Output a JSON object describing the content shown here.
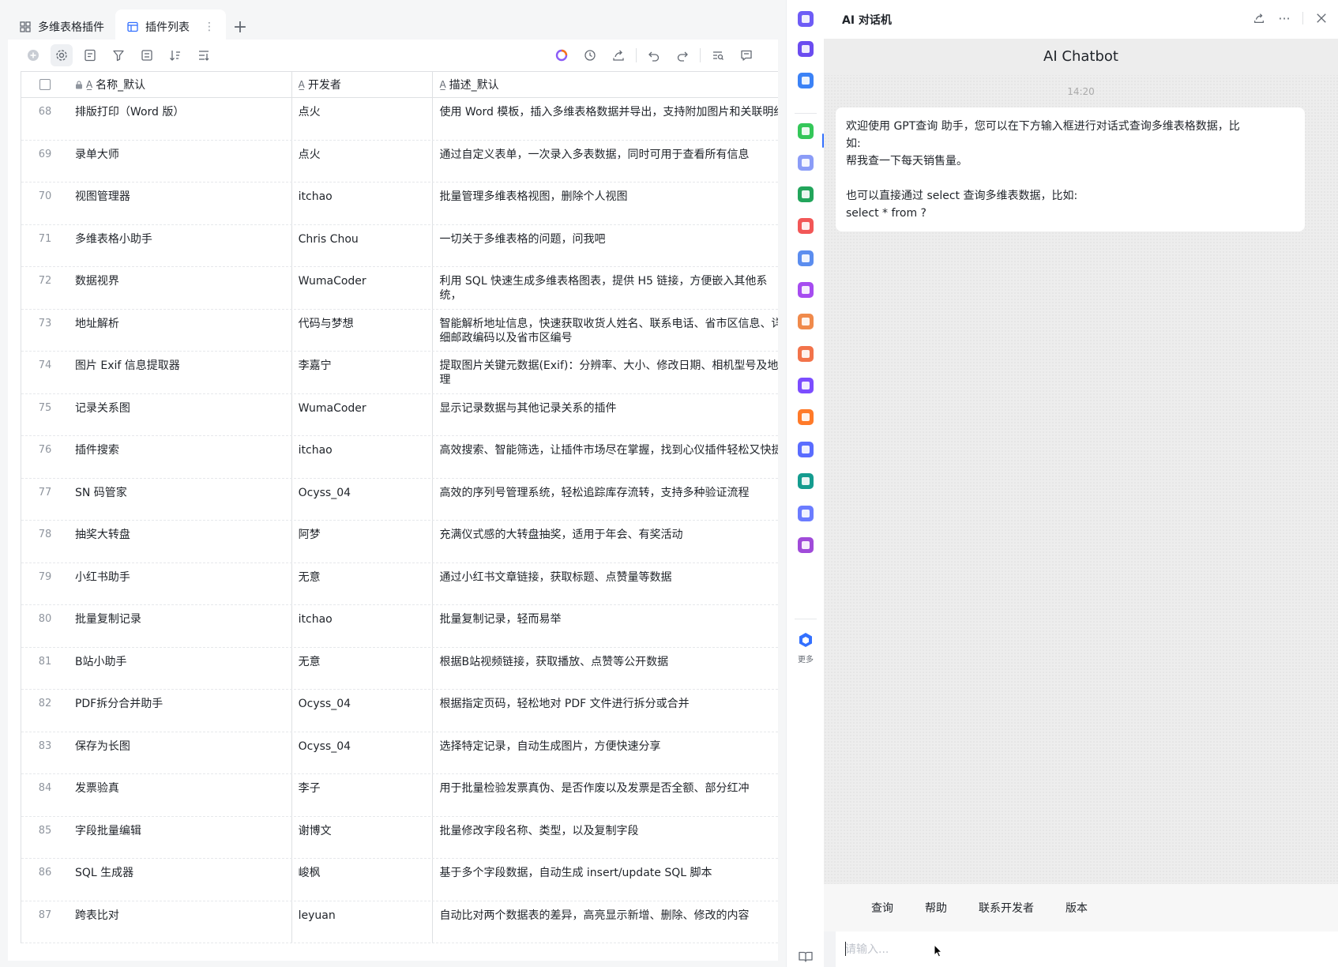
{
  "tabs": [
    {
      "label": "多维表格插件",
      "icon": "grid-icon",
      "active": false
    },
    {
      "label": "插件列表",
      "icon": "table-icon",
      "active": true
    }
  ],
  "table": {
    "columns": [
      {
        "label": "名称_默认",
        "icon": "text-field-icon",
        "locked": true
      },
      {
        "label": "开发者",
        "icon": "text-field-icon"
      },
      {
        "label": "描述_默认",
        "icon": "text-field-icon"
      }
    ],
    "rows": [
      {
        "idx": "68",
        "name": "排版打印（Word 版）",
        "dev": "点火",
        "desc": "使用 Word 模板，插入多维表格数据并导出，支持附加图片和关联明细"
      },
      {
        "idx": "69",
        "name": "录单大师",
        "dev": "点火",
        "desc": "通过自定义表单，一次录入多表数据，同时可用于查看所有信息"
      },
      {
        "idx": "70",
        "name": "视图管理器",
        "dev": "itchao",
        "desc": "批量管理多维表格视图，删除个人视图"
      },
      {
        "idx": "71",
        "name": "多维表格小助手",
        "dev": "Chris Chou",
        "desc": "一切关于多维表格的问题，问我吧"
      },
      {
        "idx": "72",
        "name": "数据视界",
        "dev": "WumaCoder",
        "desc": "利用 SQL 快速生成多维表格图表，提供 H5 链接，方便嵌入其他系统，"
      },
      {
        "idx": "73",
        "name": "地址解析",
        "dev": "代码与梦想",
        "desc": "智能解析地址信息，快速获取收货人姓名、联系电话、省市区信息、详细邮政编码以及省市区编号"
      },
      {
        "idx": "74",
        "name": "图片 Exif 信息提取器",
        "dev": "李嘉宁",
        "desc": "提取图片关键元数据(Exif)：分辨率、大小、修改日期、相机型号及地理"
      },
      {
        "idx": "75",
        "name": "记录关系图",
        "dev": "WumaCoder",
        "desc": "显示记录数据与其他记录关系的插件"
      },
      {
        "idx": "76",
        "name": "插件搜索",
        "dev": "itchao",
        "desc": "高效搜索、智能筛选，让插件市场尽在掌握，找到心仪插件轻松又快捷"
      },
      {
        "idx": "77",
        "name": "SN 码管家",
        "dev": "Ocyss_04",
        "desc": "高效的序列号管理系统，轻松追踪库存流转，支持多种验证流程"
      },
      {
        "idx": "78",
        "name": "抽奖大转盘",
        "dev": "阿梦",
        "desc": "充满仪式感的大转盘抽奖，适用于年会、有奖活动"
      },
      {
        "idx": "79",
        "name": "小红书助手",
        "dev": "无意",
        "desc": "通过小红书文章链接，获取标题、点赞量等数据"
      },
      {
        "idx": "80",
        "name": "批量复制记录",
        "dev": "itchao",
        "desc": "批量复制记录，轻而易举"
      },
      {
        "idx": "81",
        "name": "B站小助手",
        "dev": "无意",
        "desc": "根据B站视频链接，获取播放、点赞等公开数据"
      },
      {
        "idx": "82",
        "name": "PDF拆分合并助手",
        "dev": "Ocyss_04",
        "desc": "根据指定页码，轻松地对 PDF 文件进行拆分或合并"
      },
      {
        "idx": "83",
        "name": "保存为长图",
        "dev": "Ocyss_04",
        "desc": "选择特定记录，自动生成图片，方便快速分享"
      },
      {
        "idx": "84",
        "name": "发票验真",
        "dev": "李子",
        "desc": "用于批量检验发票真伪、是否作废以及发票是否全额、部分红冲"
      },
      {
        "idx": "85",
        "name": "字段批量编辑",
        "dev": "谢博文",
        "desc": "批量修改字段名称、类型，以及复制字段"
      },
      {
        "idx": "86",
        "name": "SQL 生成器",
        "dev": "峻枫",
        "desc": "基于多个字段数据，自动生成 insert/update SQL 脚本"
      },
      {
        "idx": "87",
        "name": "跨表比对",
        "dev": "leyuan",
        "desc": "自动比对两个数据表的差异，高亮显示新增、删除、修改的内容"
      }
    ]
  },
  "rail": {
    "more_label": "更多",
    "icon_colors": [
      "#6e5cf6",
      "#6b4cf0",
      "#3b82f6",
      "#34c759",
      "#8b9cf7",
      "#22a55b",
      "#f25757",
      "#5b8def",
      "#a64cf0",
      "#f08a4b",
      "#f2734a",
      "#7c4dff",
      "#ff7a29",
      "#5a6cff",
      "#149c8f",
      "#6b7cff",
      "#a04bd9"
    ]
  },
  "chat": {
    "panel_title": "AI 对话机",
    "bot_name": "AI Chatbot",
    "time": "14:20",
    "message_lines": [
      "欢迎使用 GPT查询 助手，您可以在下方输入框进行对话式查询多维表格数据，比",
      "如:",
      "帮我查一下每天销售量。",
      "",
      "也可以直接通过 select 查询多维表数据，比如:",
      "select * from ?"
    ],
    "quick_actions": [
      "查询",
      "帮助",
      "联系开发者",
      "版本"
    ],
    "input_placeholder": "请输入..."
  }
}
